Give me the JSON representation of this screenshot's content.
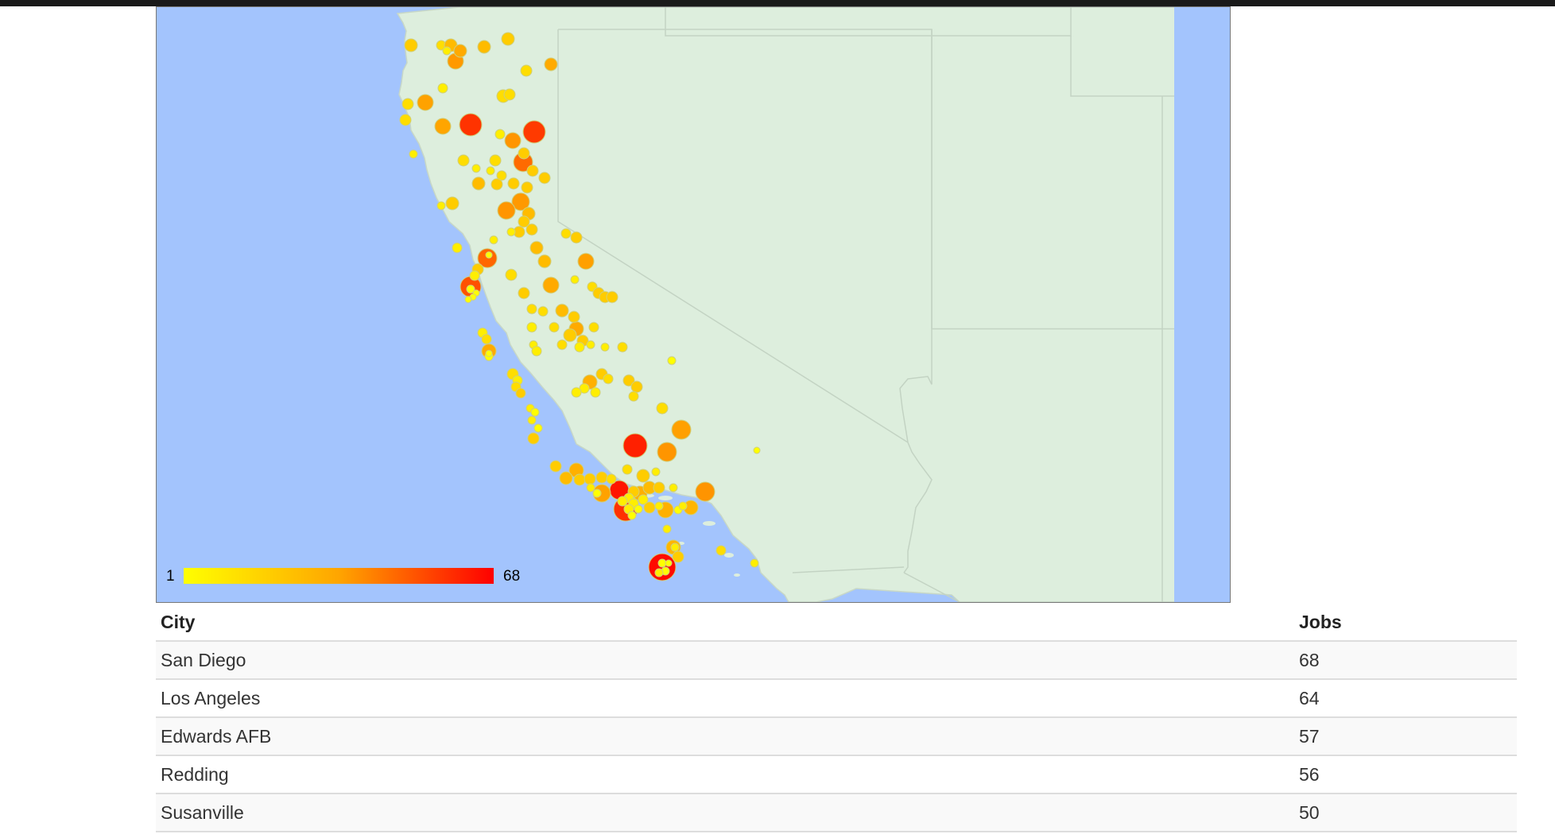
{
  "map": {
    "legend": {
      "min_label": "1",
      "max_label": "68",
      "min_color": "#ffff00",
      "mid_color": "#ffa500",
      "max_color": "#ff0000"
    },
    "colors": {
      "ocean": "#a3c4fd",
      "land": "#ddeedd",
      "border": "#bbcbbb"
    }
  },
  "table": {
    "headers": {
      "city": "City",
      "jobs": "Jobs"
    },
    "rows": [
      {
        "city": "San Diego",
        "jobs": "68"
      },
      {
        "city": "Los Angeles",
        "jobs": "64"
      },
      {
        "city": "Edwards AFB",
        "jobs": "57"
      },
      {
        "city": "Redding",
        "jobs": "56"
      },
      {
        "city": "Susanville",
        "jobs": "50"
      }
    ]
  }
}
